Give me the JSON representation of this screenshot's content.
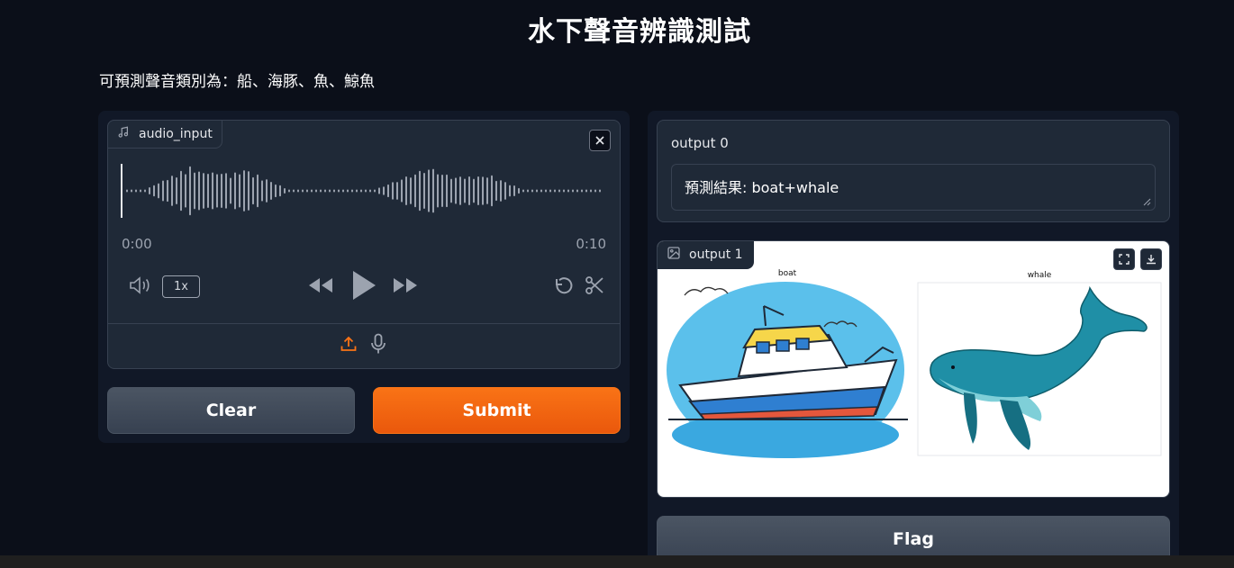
{
  "page": {
    "title": "水下聲音辨識測試",
    "description": "可預測聲音類別為：船、海豚、魚、鯨魚"
  },
  "audio_input": {
    "label": "audio_input",
    "time_start": "0:00",
    "time_end": "0:10",
    "playback_speed": "1x"
  },
  "buttons": {
    "clear": "Clear",
    "submit": "Submit",
    "flag": "Flag"
  },
  "output0": {
    "label": "output 0",
    "value": "預測結果: boat+whale"
  },
  "output1": {
    "label": "output 1",
    "image_titles": [
      "boat",
      "whale"
    ]
  },
  "colors": {
    "accent": "#f97316",
    "background": "#0b0f19",
    "panel": "#111827",
    "block": "#1f2937"
  }
}
